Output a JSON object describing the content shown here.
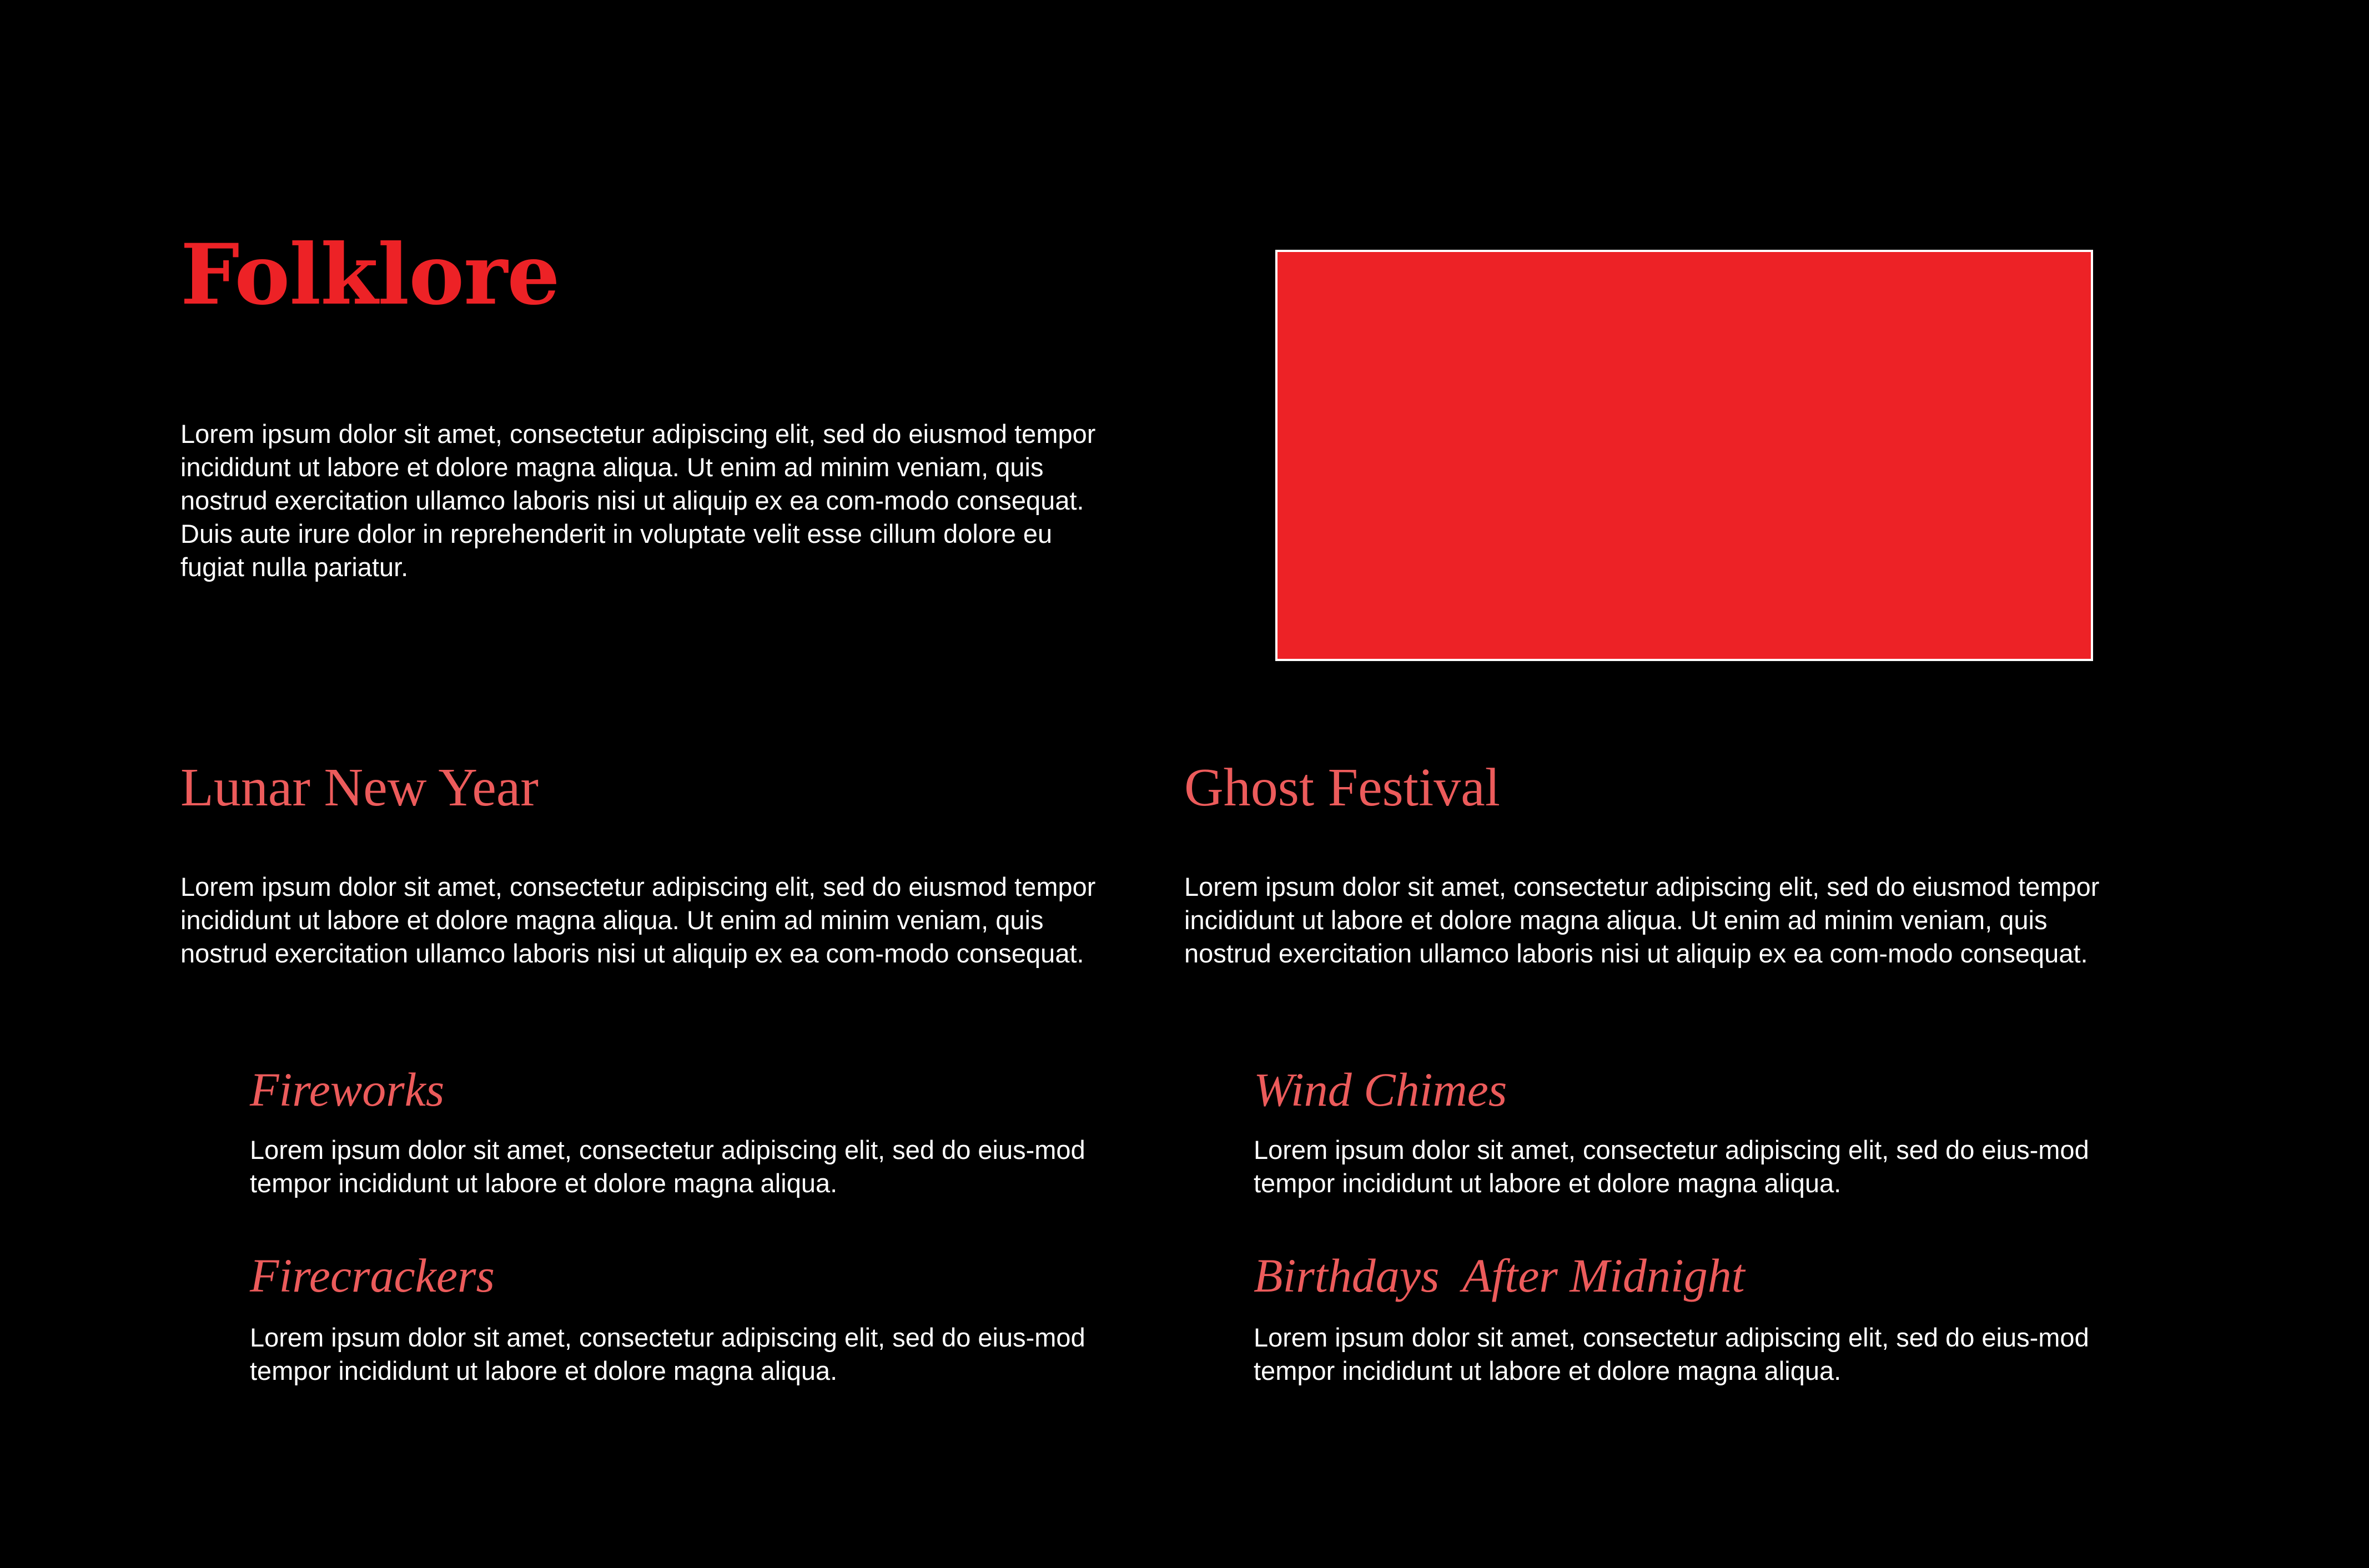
{
  "page": {
    "title": "Folklore",
    "intro": "Lorem ipsum dolor sit amet, consectetur adipiscing elit, sed do eiusmod tempor incididunt ut labore et dolore magna aliqua. Ut enim ad minim veniam, quis nostrud exercitation ullamco laboris nisi ut aliquip ex ea com-modo consequat. Duis aute irure dolor in reprehenderit in voluptate velit esse cillum dolore eu fugiat nulla pariatur.",
    "image_color": "#ed2226",
    "heading_color": "#ec5b5b"
  },
  "sections": [
    {
      "heading": "Lunar New Year",
      "text": "Lorem ipsum dolor sit amet, consectetur adipiscing elit, sed do eiusmod tempor incididunt ut labore et dolore magna aliqua. Ut enim ad minim veniam, quis nostrud exercitation ullamco laboris nisi ut aliquip ex ea com-modo consequat.",
      "subsections": [
        {
          "heading": "Fireworks",
          "text": "Lorem ipsum dolor sit amet, consectetur adipiscing elit, sed do eius-mod tempor incididunt ut labore et dolore magna aliqua."
        },
        {
          "heading": "Firecrackers",
          "text": "Lorem ipsum dolor sit amet, consectetur adipiscing elit, sed do eius-mod tempor incididunt ut labore et dolore magna aliqua."
        }
      ]
    },
    {
      "heading": "Ghost Festival",
      "text": "Lorem ipsum dolor sit amet, consectetur adipiscing elit, sed do eiusmod tempor incididunt ut labore et dolore magna aliqua. Ut enim ad minim veniam, quis nostrud exercitation ullamco laboris nisi ut aliquip ex ea com-modo consequat.",
      "subsections": [
        {
          "heading": "Wind Chimes",
          "text": "Lorem ipsum dolor sit amet, consectetur adipiscing elit, sed do eius-mod tempor incididunt ut labore et dolore magna aliqua."
        },
        {
          "heading": "Birthdays  After Midnight",
          "text": "Lorem ipsum dolor sit amet, consectetur adipiscing elit, sed do eius-mod tempor incididunt ut labore et dolore magna aliqua."
        }
      ]
    }
  ]
}
